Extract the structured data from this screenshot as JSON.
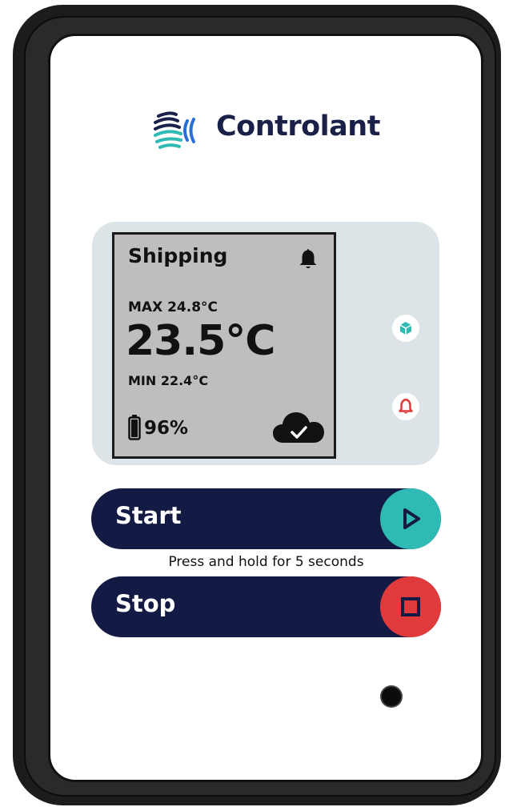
{
  "brand": {
    "name": "Controlant",
    "logo_icon": "controlant-waves-logo"
  },
  "display": {
    "mode": "Shipping",
    "max_label": "MAX 24.8°C",
    "current_temp": "23.5°C",
    "min_label": "MIN 22.4°C",
    "battery": "96%",
    "status_icons": [
      "bell-icon",
      "battery-icon",
      "cloud-check-icon"
    ]
  },
  "indicators": [
    {
      "name": "box-indicator-icon",
      "color": "#2fbab3"
    },
    {
      "name": "alarm-indicator-icon",
      "color": "#e03a3c"
    }
  ],
  "buttons": {
    "start_label": "Start",
    "hint": "Press and hold for 5 seconds",
    "stop_label": "Stop",
    "start_color": "#2fbab3",
    "stop_color": "#e03a3c",
    "bar_color": "#131b45"
  }
}
